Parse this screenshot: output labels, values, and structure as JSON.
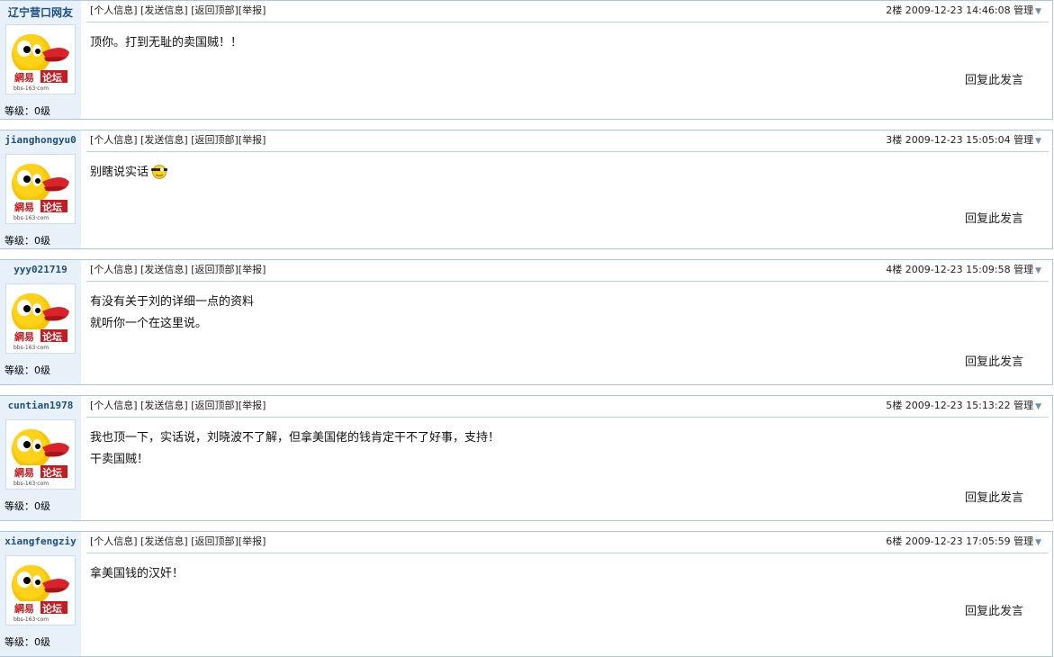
{
  "common": {
    "link_profile": "[个人信息]",
    "link_message": "[发送信息]",
    "link_top": "[返回顶部]",
    "link_report": "[举报]",
    "manage_label": "管理",
    "reply_label": "回复此发言",
    "level_label": "等级：0级",
    "avatar_brand_left": "網易",
    "avatar_brand_right": "论坛",
    "avatar_url_text": "bbs-163·com"
  },
  "posts": [
    {
      "username": "辽宁营口网友",
      "floor": "2楼",
      "datetime": "2009-12-23 14:46:08",
      "lines": [
        "顶你。打到无耻的卖国贼！！"
      ]
    },
    {
      "username": "jianghongyu0",
      "floor": "3楼",
      "datetime": "2009-12-23 15:05:04",
      "lines": [
        "别瞎说实话"
      ],
      "emoji": "wink-face-icon"
    },
    {
      "username": "yyy021719",
      "floor": "4楼",
      "datetime": "2009-12-23 15:09:58",
      "lines": [
        "有没有关于刘的详细一点的资料",
        "就听你一个在这里说。"
      ]
    },
    {
      "username": "cuntian1978",
      "floor": "5楼",
      "datetime": "2009-12-23 15:13:22",
      "lines": [
        "我也顶一下，实话说，刘晓波不了解，但拿美国佬的钱肯定干不了好事，支持！",
        "干卖国贼！"
      ]
    },
    {
      "username": "xiangfengziy",
      "floor": "6楼",
      "datetime": "2009-12-23 17:05:59",
      "lines": [
        "拿美国钱的汉奸！"
      ]
    }
  ]
}
